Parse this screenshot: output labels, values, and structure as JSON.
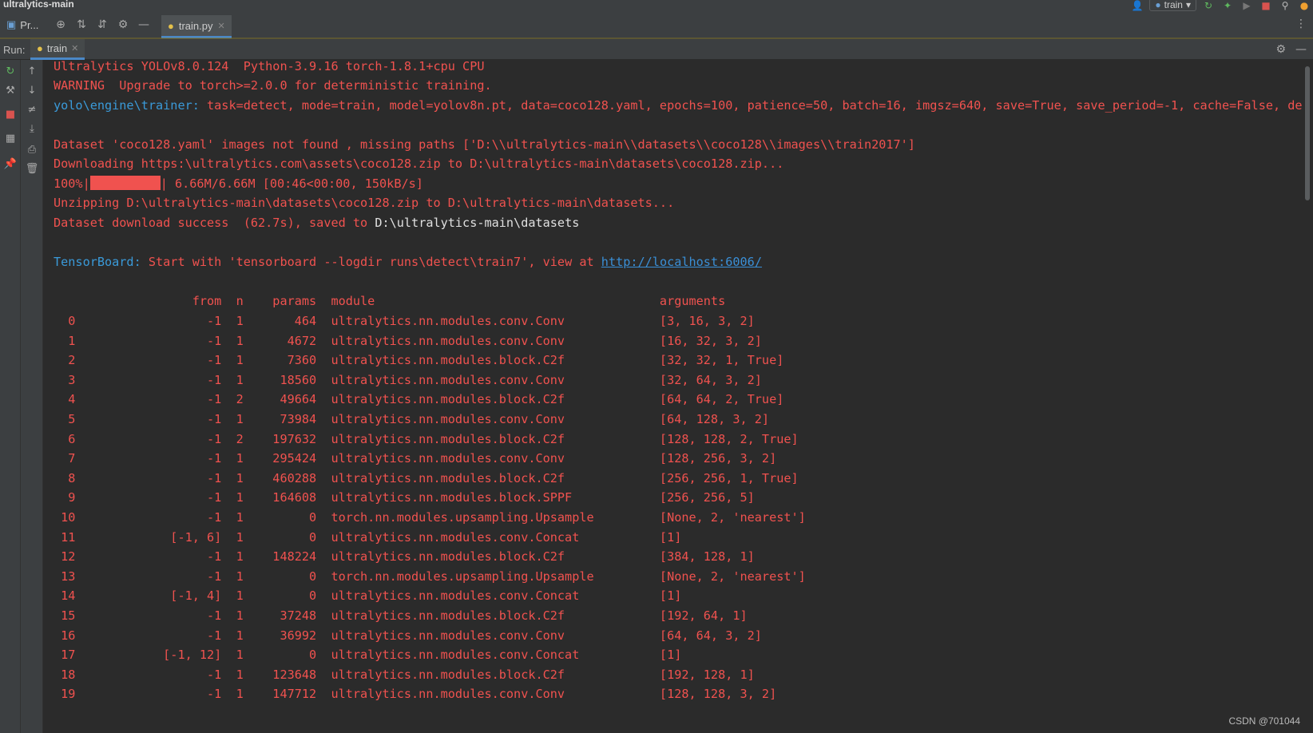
{
  "window": {
    "project_name": "ultralytics-main"
  },
  "toolbar": {
    "run_config": "train"
  },
  "tabs": {
    "project_tab": "Pr...",
    "file_tab": "train.py"
  },
  "run": {
    "label": "Run:",
    "tab": "train"
  },
  "console": {
    "line1": "Ultralytics YOLOv8.0.124  Python-3.9.16 torch-1.8.1+cpu CPU",
    "line2": "WARNING  Upgrade to torch>=2.0.0 for deterministic training.",
    "trainer_prefix": "yolo\\engine\\trainer:",
    "trainer_args": " task=detect, mode=train, model=yolov8n.pt, data=coco128.yaml, epochs=100, patience=50, batch=16, imgsz=640, save=True, save_period=-1, cache=False, de",
    "dataset_missing": "Dataset 'coco128.yaml' images not found , missing paths ['D:\\\\ultralytics-main\\\\datasets\\\\coco128\\\\images\\\\train2017']",
    "downloading": "Downloading https:\\ultralytics.com\\assets\\coco128.zip to D:\\ultralytics-main\\datasets\\coco128.zip...",
    "progress_pct": "100%|",
    "progress_tail": "| 6.66M/6.66M [00:46<00:00, 150kB/s]",
    "unzipping": "Unzipping D:\\ultralytics-main\\datasets\\coco128.zip to D:\\ultralytics-main\\datasets...",
    "download_success": "Dataset download success  (62.7s), saved to ",
    "download_path": "D:\\ultralytics-main\\datasets",
    "tb_prefix": "TensorBoard:",
    "tb_text": " Start with 'tensorboard --logdir runs\\detect\\train7', view at ",
    "tb_link": "http://localhost:6006/",
    "table_header": "                   from  n    params  module                                       arguments",
    "rows": [
      "  0                  -1  1       464  ultralytics.nn.modules.conv.Conv             [3, 16, 3, 2]",
      "  1                  -1  1      4672  ultralytics.nn.modules.conv.Conv             [16, 32, 3, 2]",
      "  2                  -1  1      7360  ultralytics.nn.modules.block.C2f             [32, 32, 1, True]",
      "  3                  -1  1     18560  ultralytics.nn.modules.conv.Conv             [32, 64, 3, 2]",
      "  4                  -1  2     49664  ultralytics.nn.modules.block.C2f             [64, 64, 2, True]",
      "  5                  -1  1     73984  ultralytics.nn.modules.conv.Conv             [64, 128, 3, 2]",
      "  6                  -1  2    197632  ultralytics.nn.modules.block.C2f             [128, 128, 2, True]",
      "  7                  -1  1    295424  ultralytics.nn.modules.conv.Conv             [128, 256, 3, 2]",
      "  8                  -1  1    460288  ultralytics.nn.modules.block.C2f             [256, 256, 1, True]",
      "  9                  -1  1    164608  ultralytics.nn.modules.block.SPPF            [256, 256, 5]",
      " 10                  -1  1         0  torch.nn.modules.upsampling.Upsample         [None, 2, 'nearest']",
      " 11             [-1, 6]  1         0  ultralytics.nn.modules.conv.Concat           [1]",
      " 12                  -1  1    148224  ultralytics.nn.modules.block.C2f             [384, 128, 1]",
      " 13                  -1  1         0  torch.nn.modules.upsampling.Upsample         [None, 2, 'nearest']",
      " 14             [-1, 4]  1         0  ultralytics.nn.modules.conv.Concat           [1]",
      " 15                  -1  1     37248  ultralytics.nn.modules.block.C2f             [192, 64, 1]",
      " 16                  -1  1     36992  ultralytics.nn.modules.conv.Conv             [64, 64, 3, 2]",
      " 17            [-1, 12]  1         0  ultralytics.nn.modules.conv.Concat           [1]",
      " 18                  -1  1    123648  ultralytics.nn.modules.block.C2f             [192, 128, 1]",
      " 19                  -1  1    147712  ultralytics.nn.modules.conv.Conv             [128, 128, 3, 2]"
    ]
  },
  "watermark": "CSDN @701044",
  "colors": {
    "error_text": "#f0524f",
    "prefix_blue": "#3a9ad9",
    "link_blue": "#3a8fd6",
    "background": "#2b2b2b"
  }
}
